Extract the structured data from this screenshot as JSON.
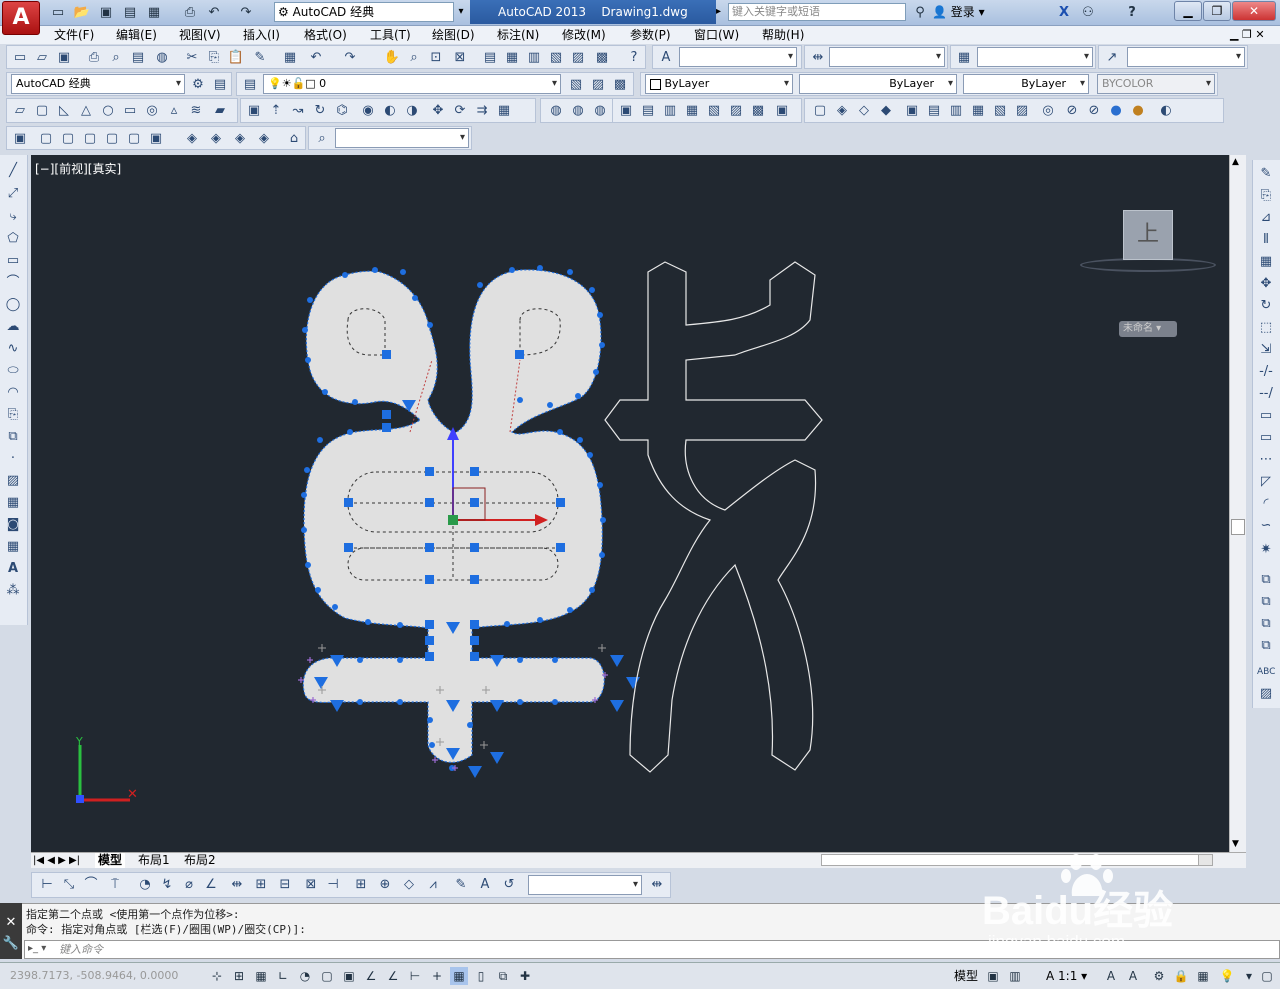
{
  "titlebar": {
    "app_logo": "A",
    "workspace": "AutoCAD 经典",
    "app_name": "AutoCAD 2013",
    "doc_name": "Drawing1.dwg",
    "search_placeholder": "键入关键字或短语",
    "login": "登录",
    "help": "?"
  },
  "menu": [
    "文件(F)",
    "编辑(E)",
    "视图(V)",
    "插入(I)",
    "格式(O)",
    "工具(T)",
    "绘图(D)",
    "标注(N)",
    "修改(M)",
    "参数(P)",
    "窗口(W)",
    "帮助(H)"
  ],
  "toolbar2": {
    "workspace": "AutoCAD 经典",
    "layer": "0",
    "color": "ByLayer",
    "linetype": "ByLayer",
    "lineweight": "ByLayer",
    "plotstyle": "BYCOLOR"
  },
  "viewport": {
    "label": "[−][前视][真实]",
    "viewcube_face": "上",
    "viewcube_wcs": "未命名"
  },
  "layout_tabs": [
    "模型",
    "布局1",
    "布局2"
  ],
  "command": {
    "line1": "指定第二个点或 <使用第一个点作为位移>:",
    "line2": "命令: 指定对角点或 [栏选(F)/圈围(WP)/圈交(CP)]:",
    "input_placeholder": "键入命令"
  },
  "status": {
    "coords": "2398.7173, -508.9464, 0.0000",
    "model": "模型",
    "scale": "1:1"
  },
  "watermark": {
    "brand": "Baidu经验",
    "url": "jingyan.baidu.com"
  }
}
